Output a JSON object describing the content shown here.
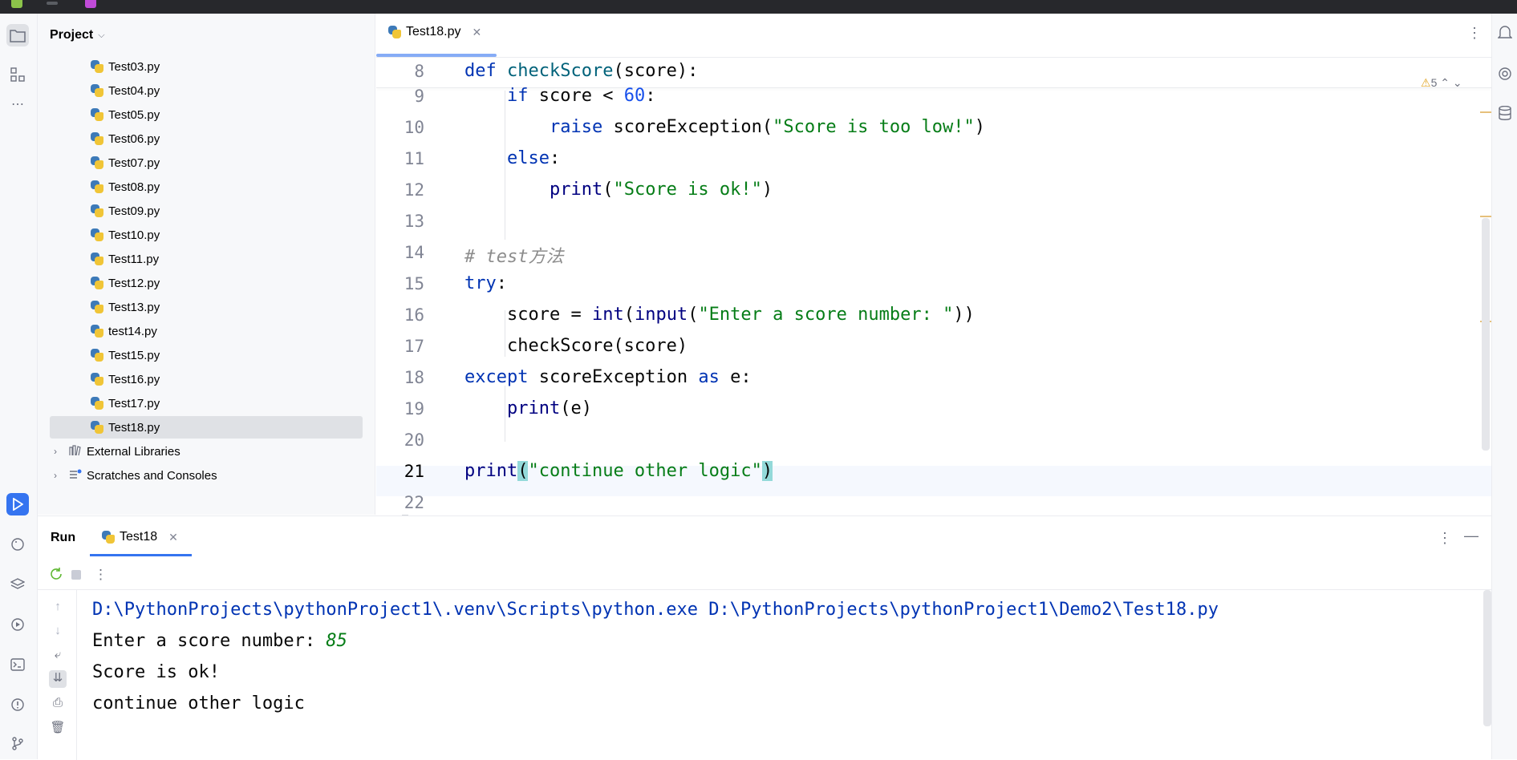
{
  "editor": {
    "tab_label": "Test18.py",
    "warning_count": "5",
    "lines": [
      {
        "n": "8"
      },
      {
        "n": "9"
      },
      {
        "n": "10"
      },
      {
        "n": "11"
      },
      {
        "n": "12"
      },
      {
        "n": "13"
      },
      {
        "n": "14"
      },
      {
        "n": "15"
      },
      {
        "n": "16"
      },
      {
        "n": "17"
      },
      {
        "n": "18"
      },
      {
        "n": "19"
      },
      {
        "n": "20"
      },
      {
        "n": "21"
      },
      {
        "n": "22"
      }
    ],
    "code": {
      "l8_def": "def",
      "l8_name": "checkScore",
      "l8_rest": "(score):",
      "l9_kw": "if",
      "l9_mid": " score < ",
      "l9_num": "60",
      "l9_end": ":",
      "l10_kw": "raise",
      "l10_mid": " scoreException(",
      "l10_str": "\"Score is too low!\"",
      "l10_end": ")",
      "l11_kw": "else",
      "l11_end": ":",
      "l12_fn": "print",
      "l12_open": "(",
      "l12_str": "\"Score is ok!\"",
      "l12_end": ")",
      "l14_comment": "# test方法",
      "l15_kw": "try",
      "l15_end": ":",
      "l16_a": "score = ",
      "l16_int": "int",
      "l16_b": "(",
      "l16_input": "input",
      "l16_c": "(",
      "l16_str": "\"Enter a score number: \"",
      "l16_d": "))",
      "l17": "checkScore(score)",
      "l18_kw": "except",
      "l18_mid": " scoreException ",
      "l18_as": "as",
      "l18_end": " e:",
      "l19_fn": "print",
      "l19_end": "(e)",
      "l21_fn": "print",
      "l21_open": "(",
      "l21_str": "\"continue other logic\"",
      "l21_close": ")"
    }
  },
  "project": {
    "title": "Project",
    "files": [
      "Test03.py",
      "Test04.py",
      "Test05.py",
      "Test06.py",
      "Test07.py",
      "Test08.py",
      "Test09.py",
      "Test10.py",
      "Test11.py",
      "Test12.py",
      "Test13.py",
      "test14.py",
      "Test15.py",
      "Test16.py",
      "Test17.py",
      "Test18.py"
    ],
    "selected_file": "Test18.py",
    "external_libraries": "External Libraries",
    "scratches": "Scratches and Consoles"
  },
  "run": {
    "title": "Run",
    "tab_label": "Test18",
    "console": {
      "command": "D:\\PythonProjects\\pythonProject1\\.venv\\Scripts\\python.exe D:\\PythonProjects\\pythonProject1\\Demo2\\Test18.py",
      "prompt": "Enter a score number: ",
      "user_input": "85",
      "out1": "Score is ok!",
      "out2": "continue other logic"
    }
  },
  "colors": {
    "keyword": "#0033b3",
    "string": "#067d17",
    "number": "#1750eb",
    "comment": "#8c8c8c",
    "accent": "#3574f0",
    "bracket_highlight": "#93d9d9"
  }
}
